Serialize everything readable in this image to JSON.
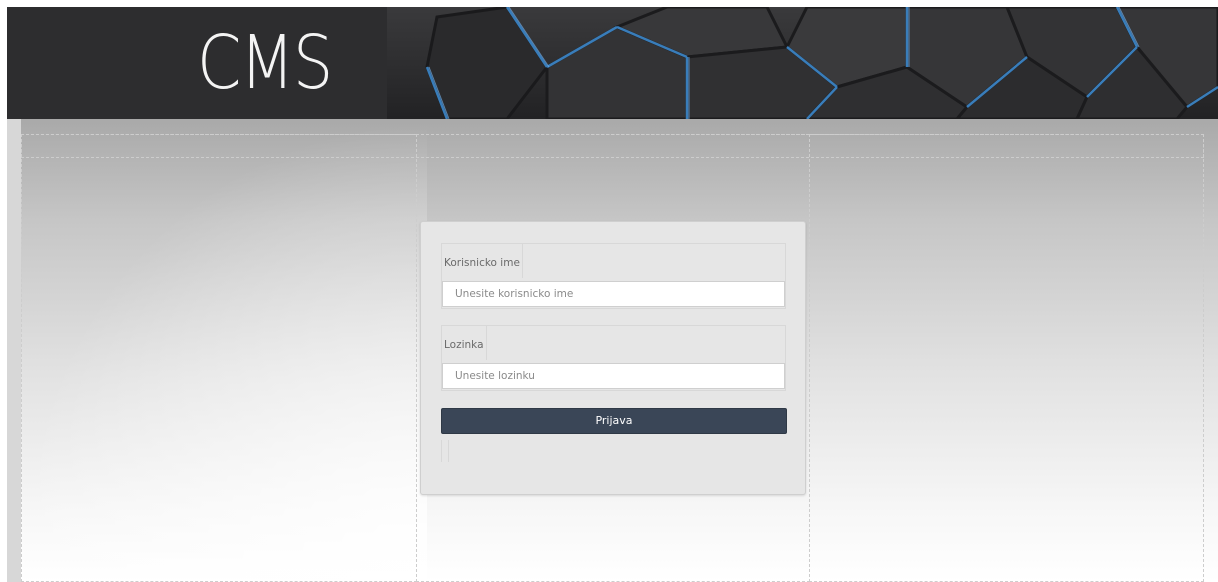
{
  "header": {
    "logo_text": "CMS"
  },
  "login": {
    "username": {
      "label": "Korisnicko ime",
      "placeholder": "Unesite korisnicko ime",
      "value": ""
    },
    "password": {
      "label": "Lozinka",
      "placeholder": "Unesite lozinku",
      "value": ""
    },
    "submit_label": "Prijava"
  },
  "colors": {
    "header_bg": "#2e2e30",
    "accent_blue": "#3f8fd6",
    "button_bg": "#3a4657",
    "panel_bg": "#e6e6e6"
  }
}
